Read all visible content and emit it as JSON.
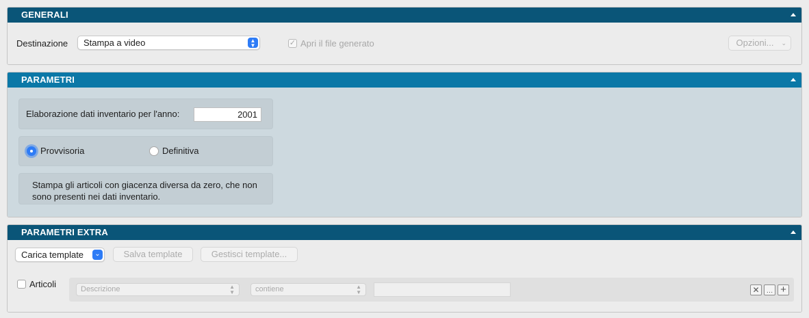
{
  "generali": {
    "title": "GENERALI",
    "destination_label": "Destinazione",
    "destination_value": "Stampa a video",
    "open_file_label": "Apri il file generato",
    "open_file_checked": true,
    "options_button": "Opzioni..."
  },
  "parametri": {
    "title": "PARAMETRI",
    "year_label": "Elaborazione dati inventario per l'anno:",
    "year_value": "2001",
    "radio_provvisoria": "Provvisoria",
    "radio_definitiva": "Definitiva",
    "selected": "Provvisoria",
    "description": "Stampa gli articoli con giacenza diversa da zero, che non sono presenti nei dati inventario."
  },
  "extra": {
    "title": "PARAMETRI EXTRA",
    "load_template": "Carica template",
    "save_template": "Salva template",
    "manage_template": "Gestisci template...",
    "articles_label": "Articoli",
    "articles_checked": false,
    "field_popup": "Descrizione",
    "operator_popup": "contiene",
    "filter_value": ""
  },
  "icons": {
    "collapse": "chevron-up-icon",
    "remove": "close-icon",
    "more": "ellipsis-icon",
    "add": "plus-icon"
  },
  "colors": {
    "header_dark": "#0a5578",
    "header_light": "#0b78a7",
    "accent": "#2e7cf6",
    "param_bg": "#cdd9df"
  }
}
